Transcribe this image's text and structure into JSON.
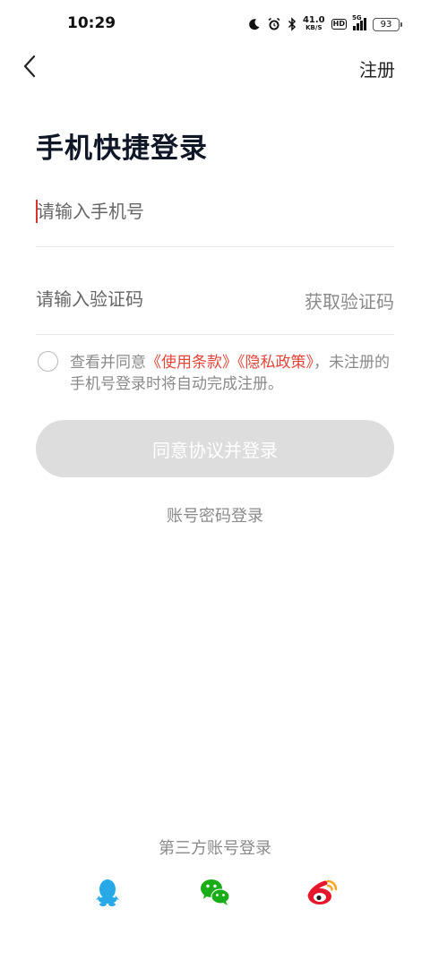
{
  "status_bar": {
    "time": "10:29",
    "net_speed_value": "41.0",
    "net_speed_unit": "KB/S",
    "hd_label": "HD",
    "network_label": "5G",
    "battery_level": "93"
  },
  "nav": {
    "back_icon": "chevron-left",
    "register_label": "注册"
  },
  "title": "手机快捷登录",
  "phone_field": {
    "placeholder": "请输入手机号",
    "value": ""
  },
  "code_field": {
    "placeholder": "请输入验证码",
    "value": "",
    "get_code_label": "获取验证码"
  },
  "agreement": {
    "checked": false,
    "prefix": "查看并同意",
    "terms_link": "《使用条款》",
    "privacy_link": "《隐私政策》",
    "suffix": "，未注册的手机号登录时将自动完成注册。"
  },
  "login_button": {
    "label": "同意协议并登录",
    "enabled": false
  },
  "password_login_label": "账号密码登录",
  "third_party": {
    "label": "第三方账号登录",
    "providers": [
      "qq",
      "wechat",
      "weibo"
    ]
  },
  "colors": {
    "accent_red": "#e0463a",
    "disabled_button": "#dddddd",
    "qq_blue": "#27a9e8",
    "wechat_green": "#1aad19",
    "weibo_red": "#e6162d",
    "weibo_orange": "#f5a623"
  }
}
